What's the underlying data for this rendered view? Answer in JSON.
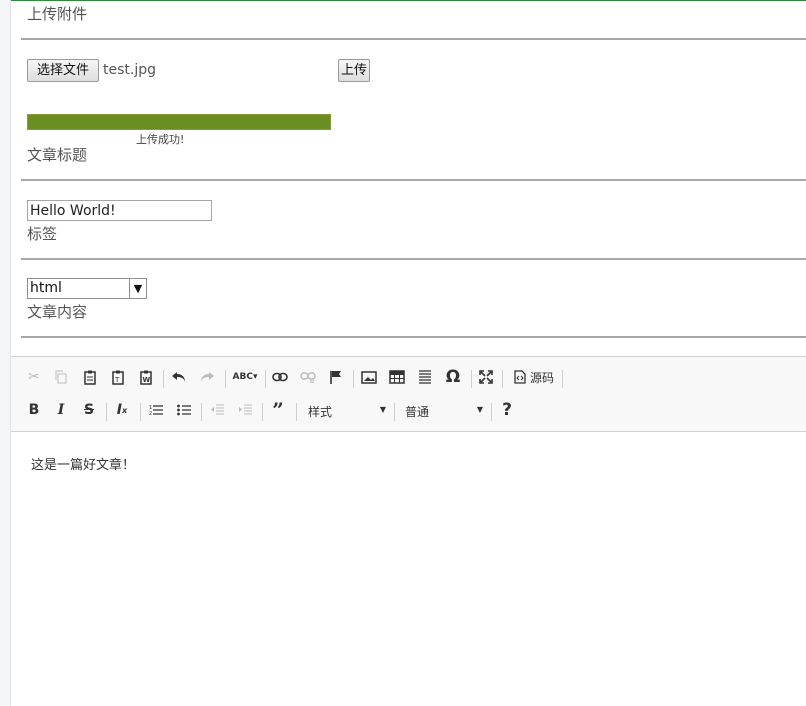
{
  "form": {
    "attachment_label": "上传附件",
    "choose_file_label": "选择文件",
    "file_name": "test.jpg",
    "upload_label": "上传",
    "progress": 1.0,
    "progress_text": "上传成功!",
    "title_label": "文章标题",
    "title_value": "Hello World!",
    "tag_label": "标签",
    "tag_selected": "html",
    "content_label": "文章内容"
  },
  "editor": {
    "source_label": "源码",
    "style_combo": "样式",
    "format_combo": "普通",
    "content_text": "这是一篇好文章！",
    "icons": [
      "cut-icon",
      "copy-icon",
      "paste-icon",
      "paste-text-icon",
      "paste-word-icon",
      "undo-icon",
      "redo-icon",
      "spellcheck-icon",
      "link-icon",
      "unlink-icon",
      "anchor-icon",
      "image-icon",
      "table-icon",
      "horizontal-line-icon",
      "special-char-icon",
      "maximize-icon",
      "source-icon",
      "bold-icon",
      "italic-icon",
      "strike-icon",
      "remove-format-icon",
      "numbered-list-icon",
      "bulleted-list-icon",
      "outdent-icon",
      "indent-icon",
      "blockquote-icon",
      "help-icon"
    ]
  },
  "colors": {
    "progress_fill": "#6b8e23",
    "top_line": "#2e8b3a"
  }
}
